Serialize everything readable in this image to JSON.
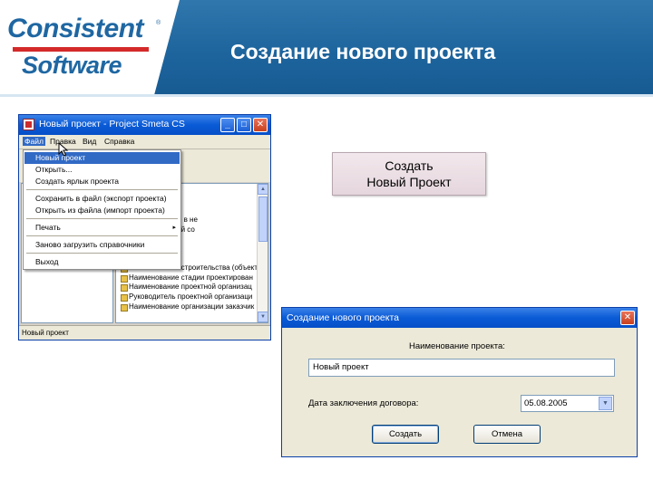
{
  "header": {
    "logo_line1": "Consistent",
    "logo_line2": "Software",
    "logo_registered": "®",
    "title": "Создание нового проекта",
    "colors": {
      "band": "#1e659d",
      "logo_blue": "#1f67a2",
      "logo_red": "#d42a2a"
    }
  },
  "main_window": {
    "title": "Новый проект - Project Smeta CS",
    "menu": [
      "Файл",
      "Правка",
      "Вид",
      "Справка"
    ],
    "file_menu": {
      "items": [
        "Новый проект",
        "Открыть...",
        "Создать ярлык проекта",
        "Сохранить в файл (экспорт проекта)",
        "Открыть из файла (импорт проекта)",
        "Печать",
        "Заново загрузить справочники",
        "Выход"
      ],
      "active_index": 0,
      "submenu_arrow": "▸"
    },
    "tree_rows": [
      "договора",
      "идации",
      "умента о изн. к- в не",
      "ло рабочих дней со",
      "ж",
      "говора",
      "роекта",
      "Наименование строительства (объект",
      "Наименование стадии проектирован",
      "Наименование проектной организац",
      "Руководитель проектной организаци",
      "Наименование организации заказчик"
    ],
    "status": "Новый проект",
    "icons": {
      "minimize": "_",
      "maximize": "□",
      "close": "✕",
      "scroll_up": "▲",
      "scroll_down": "▼"
    }
  },
  "callout": {
    "line1": "Создать",
    "line2": "Новый Проект"
  },
  "dialog": {
    "title": "Создание нового проекта",
    "name_label": "Наименование проекта:",
    "name_value": "Новый проект",
    "date_label": "Дата заключения договора:",
    "date_value": "05.08.2005",
    "create_button": "Создать",
    "cancel_button": "Отмена",
    "icons": {
      "close": "✕",
      "dropdown": "▼"
    }
  }
}
